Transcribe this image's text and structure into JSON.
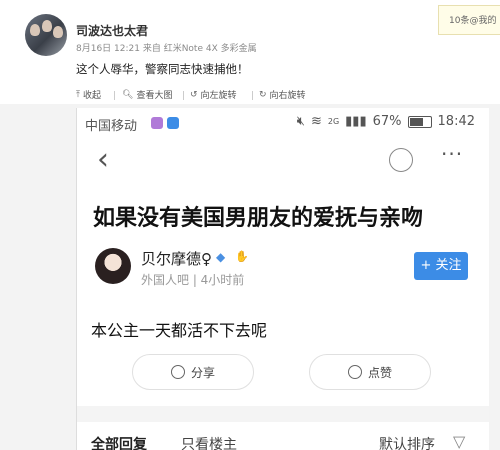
{
  "weibo": {
    "author": "司波达也太君",
    "meta": "8月16日 12:21 来自 红米Note 4X 多彩金属",
    "text": "这个人辱华，警察同志快速捕他！",
    "notice": "10条@我的",
    "toolbar": {
      "collapse": "收起",
      "view_large": "查看大图",
      "rotate_left": "向左旋转",
      "rotate_right": "向右旋转"
    }
  },
  "screenshot": {
    "status": {
      "carrier": "中国移动",
      "battery": "67%",
      "time": "18:42",
      "network": "2G"
    },
    "thread_title": "如果没有美国男朋友的爱抚与亲吻",
    "poster": {
      "name": "贝尔摩德♀",
      "sub": "外国人吧 | 4小时前",
      "follow": "+ 关注"
    },
    "body": "本公主一天都活不下去呢",
    "actions": {
      "share": "分享",
      "like": "点赞"
    },
    "comments": {
      "all": "全部回复",
      "owner_only": "只看楼主",
      "sort": "默认排序"
    }
  }
}
